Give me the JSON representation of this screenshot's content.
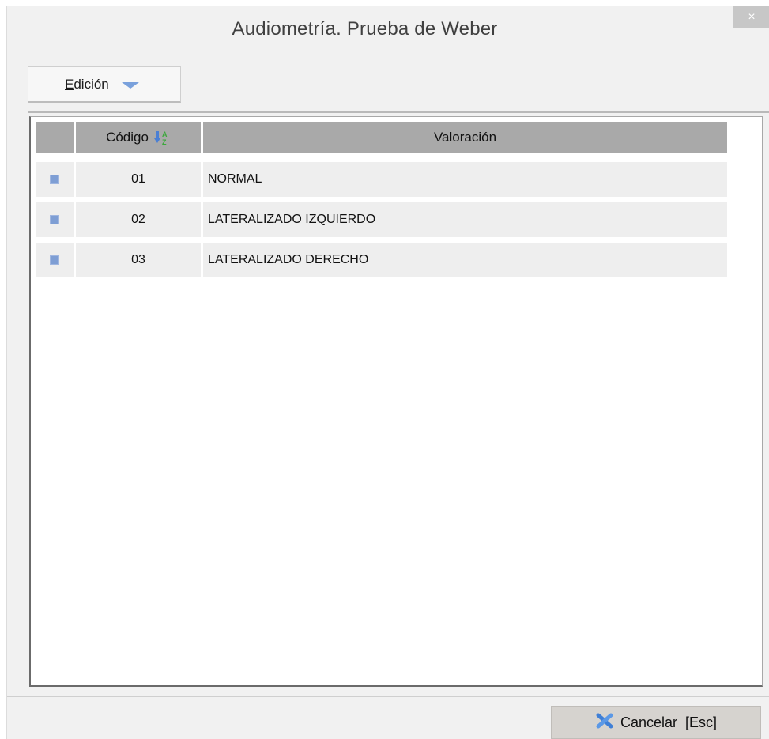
{
  "window": {
    "title": "Audiometría. Prueba de Weber",
    "close_label": "×"
  },
  "toolbar": {
    "menu_label_first": "E",
    "menu_label_rest": "dición"
  },
  "grid": {
    "columns": [
      {
        "label": ""
      },
      {
        "label": "Código"
      },
      {
        "label": "Valoración"
      }
    ],
    "rows": [
      {
        "code": "01",
        "value": "NORMAL"
      },
      {
        "code": "02",
        "value": "LATERALIZADO IZQUIERDO"
      },
      {
        "code": "03",
        "value": "LATERALIZADO DERECHO"
      }
    ],
    "sort_icon": "sort-az-icon"
  },
  "footer": {
    "cancel_label": "Cancelar  [Esc]",
    "cancel_icon": "close-x-icon"
  },
  "colors": {
    "header_bg": "#a9a9a9",
    "row_bg": "#eeeeee",
    "marker": "#7e9ed4",
    "accent": "#4a7fd4"
  }
}
